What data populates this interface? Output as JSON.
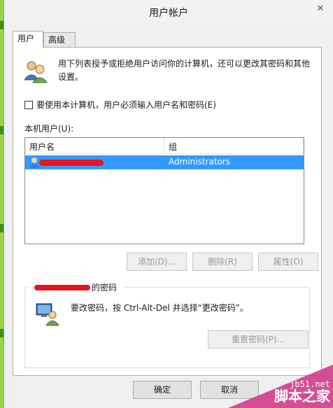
{
  "window": {
    "title": "用户帐户",
    "close_glyph": "✕"
  },
  "tabs": [
    {
      "label": "用户"
    },
    {
      "label": "高级"
    }
  ],
  "intro": {
    "text": "用下列表授予或拒绝用户访问你的计算机，还可以更改其密码和其他设置。"
  },
  "require_login": {
    "label": "要使用本计算机，用户必须输入用户名和密码(E)",
    "checked": false
  },
  "users": {
    "label": "本机用户(U):",
    "columns": [
      "用户名",
      "组"
    ],
    "rows": [
      {
        "username": "",
        "group": "Administrators"
      }
    ]
  },
  "buttons": {
    "add": "添加(D)...",
    "remove": "删除(R)",
    "properties": "属性(O)"
  },
  "password_group": {
    "title_suffix": "的密码",
    "text": "要改密码，按 Ctrl-Alt-Del 并选择“更改密码”。",
    "reset_button": "重置密码(P)..."
  },
  "dialog": {
    "ok": "确定",
    "cancel": "取消"
  },
  "watermark": {
    "site": "jb51.net",
    "brand": "脚本之家"
  },
  "colors": {
    "selection": "#3399ff",
    "redaction": "#e8131b",
    "green_strip": "#9bd24a"
  }
}
